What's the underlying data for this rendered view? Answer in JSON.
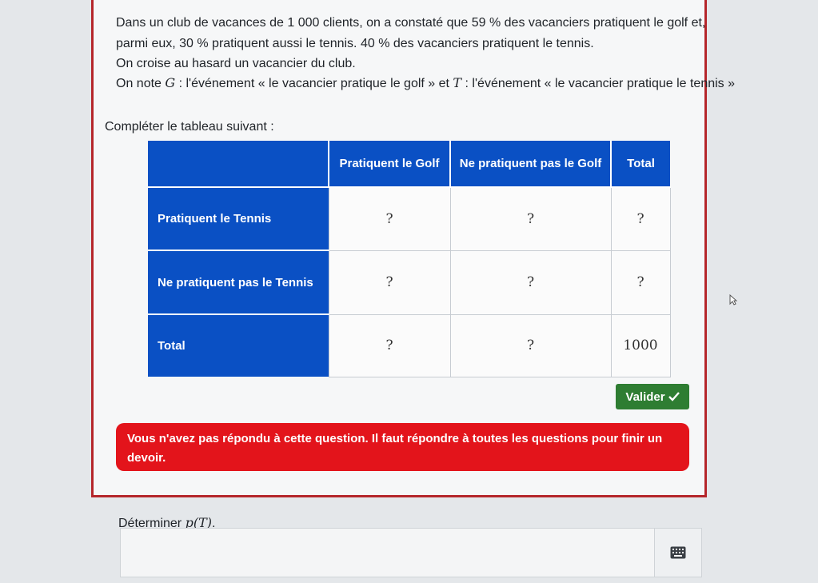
{
  "intro": {
    "line1": "Dans un club de vacances de 1 000 clients, on a constaté que 59 % des vacanciers pratiquent le golf et,",
    "line2": "parmi eux, 30 % pratiquent aussi le tennis. 40 % des vacanciers pratiquent le tennis.",
    "line3": "On croise au hasard un vacancier du club.",
    "line4_prefix": "On note ",
    "g_symbol": "G",
    "line4_mid": " : l'événement « le vacancier pratique le golf » et ",
    "t_symbol": "T",
    "line4_suffix": " : l'événement « le vacancier pratique le tennis »"
  },
  "instruction": "Compléter le tableau suivant :",
  "table": {
    "headers": [
      "Pratiquent le Golf",
      "Ne pratiquent pas le Golf",
      "Total"
    ],
    "rows": [
      {
        "label": "Pratiquent le Tennis",
        "cells": [
          "?",
          "?",
          "?"
        ]
      },
      {
        "label": "Ne pratiquent pas le Tennis",
        "cells": [
          "?",
          "?",
          "?"
        ]
      },
      {
        "label": "Total",
        "cells": [
          "?",
          "?",
          "1000"
        ]
      }
    ]
  },
  "valider_label": "Valider",
  "alert_text": "Vous n'avez pas répondu à cette question. Il faut répondre à toutes les questions pour finir un devoir.",
  "question2": {
    "prefix": "Déterminer ",
    "math": "p(T)",
    "suffix": "."
  },
  "answer_value": "",
  "icons": {
    "keyboard": "keyboard-icon",
    "check": "check-icon",
    "cursor": "mouse-cursor-icon"
  },
  "colors": {
    "header_blue": "#0a50c4",
    "alert_red": "#e3141b",
    "valider_green": "#2e7d32",
    "card_border": "#b5262b"
  }
}
